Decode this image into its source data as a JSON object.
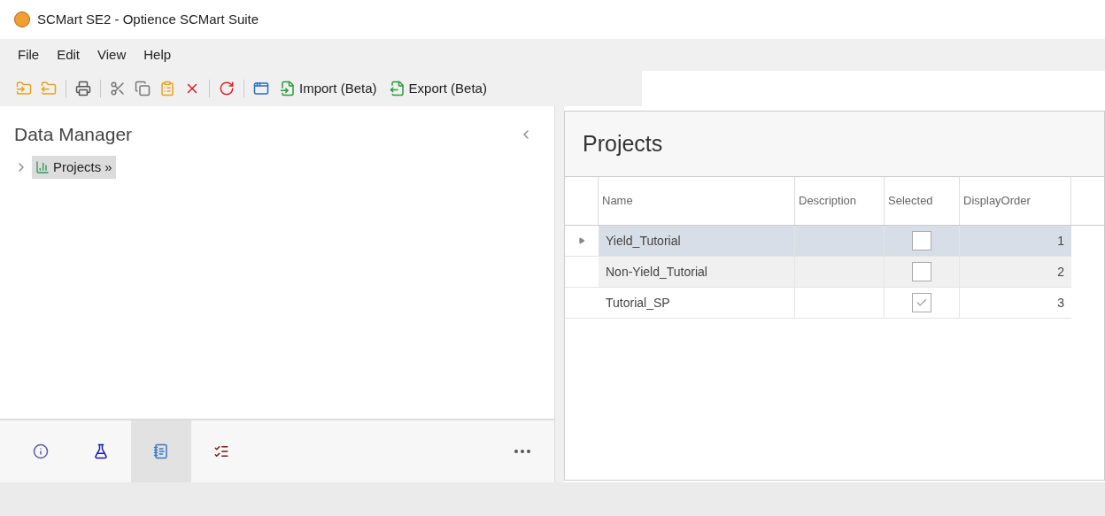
{
  "window": {
    "title": "SCMart SE2 - Optience SCMart Suite"
  },
  "menu": [
    "File",
    "Edit",
    "View",
    "Help"
  ],
  "toolbar": [
    {
      "kind": "open"
    },
    {
      "kind": "save"
    },
    {
      "kind": "separator"
    },
    {
      "kind": "print"
    },
    {
      "kind": "separator"
    },
    {
      "kind": "cut"
    },
    {
      "kind": "copy"
    },
    {
      "kind": "paste"
    },
    {
      "kind": "delete"
    },
    {
      "kind": "separator"
    },
    {
      "kind": "refresh"
    },
    {
      "kind": "separator"
    },
    {
      "kind": "info"
    },
    {
      "kind": "import",
      "label": "Import (Beta)"
    },
    {
      "kind": "export",
      "label": "Export (Beta)"
    }
  ],
  "sidebar": {
    "title": "Data Manager",
    "items": [
      {
        "label": "Projects »",
        "expanded": false,
        "selected": true
      }
    ],
    "nav": [
      {
        "kind": "info",
        "selected": false
      },
      {
        "kind": "flask",
        "selected": false
      },
      {
        "kind": "notes",
        "selected": true
      },
      {
        "kind": "checklist",
        "selected": false
      }
    ]
  },
  "panel": {
    "title": "Projects",
    "table": {
      "columns": [
        "Name",
        "Description",
        "Selected",
        "DisplayOrder"
      ],
      "rows": [
        {
          "name": "Yield_Tutorial",
          "selected": true,
          "checked": false,
          "order": "1"
        },
        {
          "name": "Non-Yield_Tutorial",
          "selected": false,
          "checked": false,
          "order": "2"
        },
        {
          "name": "Tutorial_SP",
          "selected": false,
          "checked": true,
          "order": "3"
        }
      ]
    }
  }
}
